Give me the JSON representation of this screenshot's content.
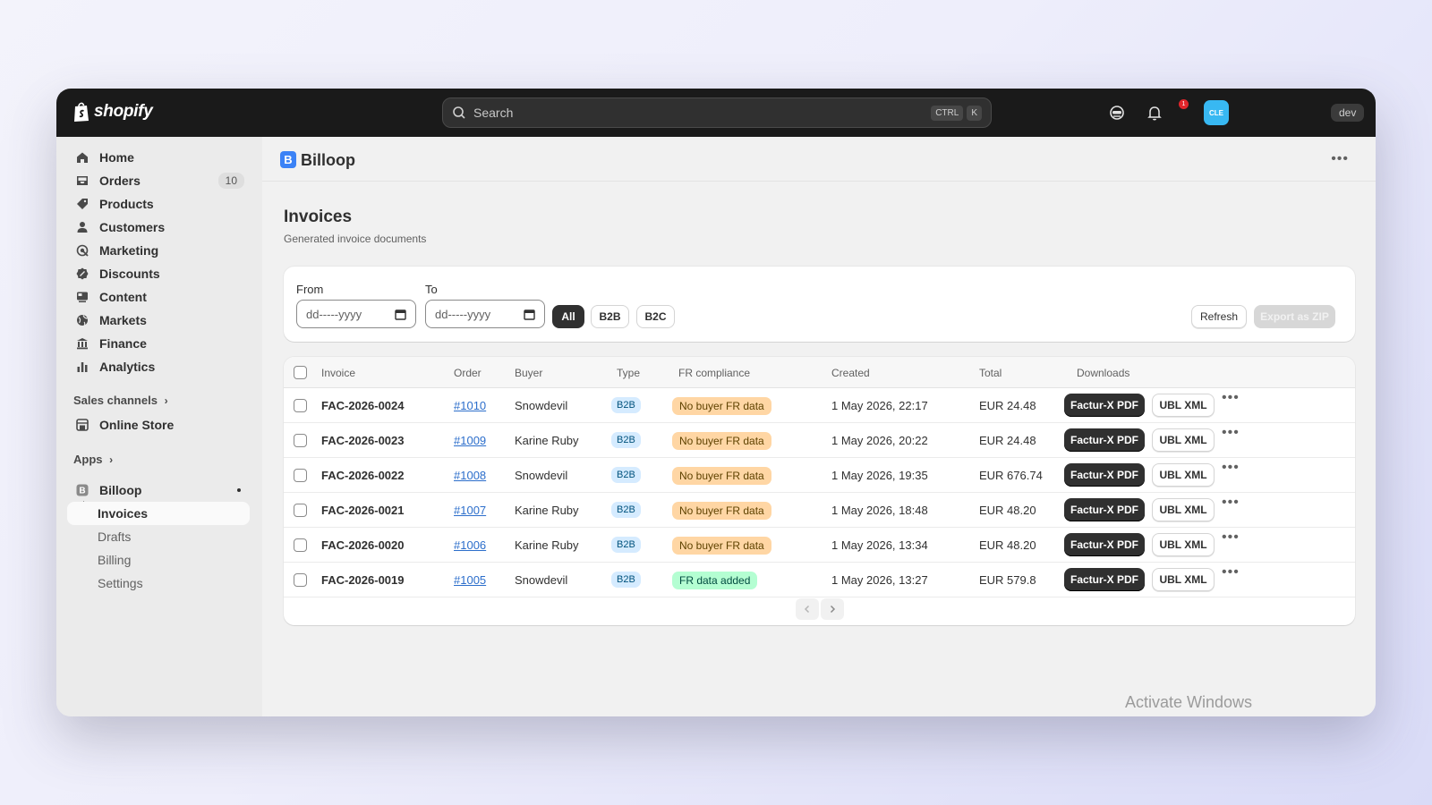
{
  "topbar": {
    "brand": "shopify",
    "search_placeholder": "Search",
    "shortcut_keys": [
      "CTRL",
      "K"
    ],
    "notification_count": "1",
    "avatar_initials": "CLE",
    "env_badge": "dev"
  },
  "sidebar": {
    "items": [
      {
        "label": "Home",
        "icon": "home-icon"
      },
      {
        "label": "Orders",
        "icon": "orders-icon",
        "count": "10"
      },
      {
        "label": "Products",
        "icon": "tag-icon"
      },
      {
        "label": "Customers",
        "icon": "person-icon"
      },
      {
        "label": "Marketing",
        "icon": "target-icon"
      },
      {
        "label": "Discounts",
        "icon": "discount-icon"
      },
      {
        "label": "Content",
        "icon": "content-icon"
      },
      {
        "label": "Markets",
        "icon": "globe-icon"
      },
      {
        "label": "Finance",
        "icon": "bank-icon"
      },
      {
        "label": "Analytics",
        "icon": "bar-chart-icon"
      }
    ],
    "sales_channels_label": "Sales channels",
    "online_store": "Online Store",
    "apps_label": "Apps",
    "app_name": "Billoop",
    "app_subitems": [
      "Invoices",
      "Drafts",
      "Billing",
      "Settings"
    ]
  },
  "app": {
    "name": "Billoop",
    "logo_letter": "B"
  },
  "page": {
    "title": "Invoices",
    "subtitle": "Generated invoice documents"
  },
  "filters": {
    "from_label": "From",
    "to_label": "To",
    "date_placeholder": "dd-----yyyy",
    "segments": [
      "All",
      "B2B",
      "B2C"
    ],
    "active_segment": "All",
    "refresh": "Refresh",
    "export_zip": "Export as ZIP"
  },
  "table": {
    "headers": [
      "Invoice",
      "Order",
      "Buyer",
      "Type",
      "FR compliance",
      "Created",
      "Total",
      "Downloads"
    ],
    "pdf_label": "Factur-X PDF",
    "ubl_label": "UBL XML",
    "rows": [
      {
        "invoice": "FAC-2026-0024",
        "order": "#1010",
        "buyer": "Snowdevil",
        "type": "B2B",
        "fr": "No buyer FR data",
        "fr_status": "warning",
        "created": "1 May 2026, 22:17",
        "total": "EUR 24.48"
      },
      {
        "invoice": "FAC-2026-0023",
        "order": "#1009",
        "buyer": "Karine Ruby",
        "type": "B2B",
        "fr": "No buyer FR data",
        "fr_status": "warning",
        "created": "1 May 2026, 20:22",
        "total": "EUR 24.48"
      },
      {
        "invoice": "FAC-2026-0022",
        "order": "#1008",
        "buyer": "Snowdevil",
        "type": "B2B",
        "fr": "No buyer FR data",
        "fr_status": "warning",
        "created": "1 May 2026, 19:35",
        "total": "EUR 676.74"
      },
      {
        "invoice": "FAC-2026-0021",
        "order": "#1007",
        "buyer": "Karine Ruby",
        "type": "B2B",
        "fr": "No buyer FR data",
        "fr_status": "warning",
        "created": "1 May 2026, 18:48",
        "total": "EUR 48.20"
      },
      {
        "invoice": "FAC-2026-0020",
        "order": "#1006",
        "buyer": "Karine Ruby",
        "type": "B2B",
        "fr": "No buyer FR data",
        "fr_status": "warning",
        "created": "1 May 2026, 13:34",
        "total": "EUR 48.20"
      },
      {
        "invoice": "FAC-2026-0019",
        "order": "#1005",
        "buyer": "Snowdevil",
        "type": "B2B",
        "fr": "FR data added",
        "fr_status": "success",
        "created": "1 May 2026, 13:27",
        "total": "EUR 579.8"
      }
    ]
  },
  "watermark": "Activate Windows",
  "colors": {
    "topbar_bg": "#1a1a1a",
    "accent_blue": "#3b82f6",
    "warning_pill": "#ffd6a4",
    "success_pill": "#b4fed2",
    "link": "#2c6ecb"
  }
}
